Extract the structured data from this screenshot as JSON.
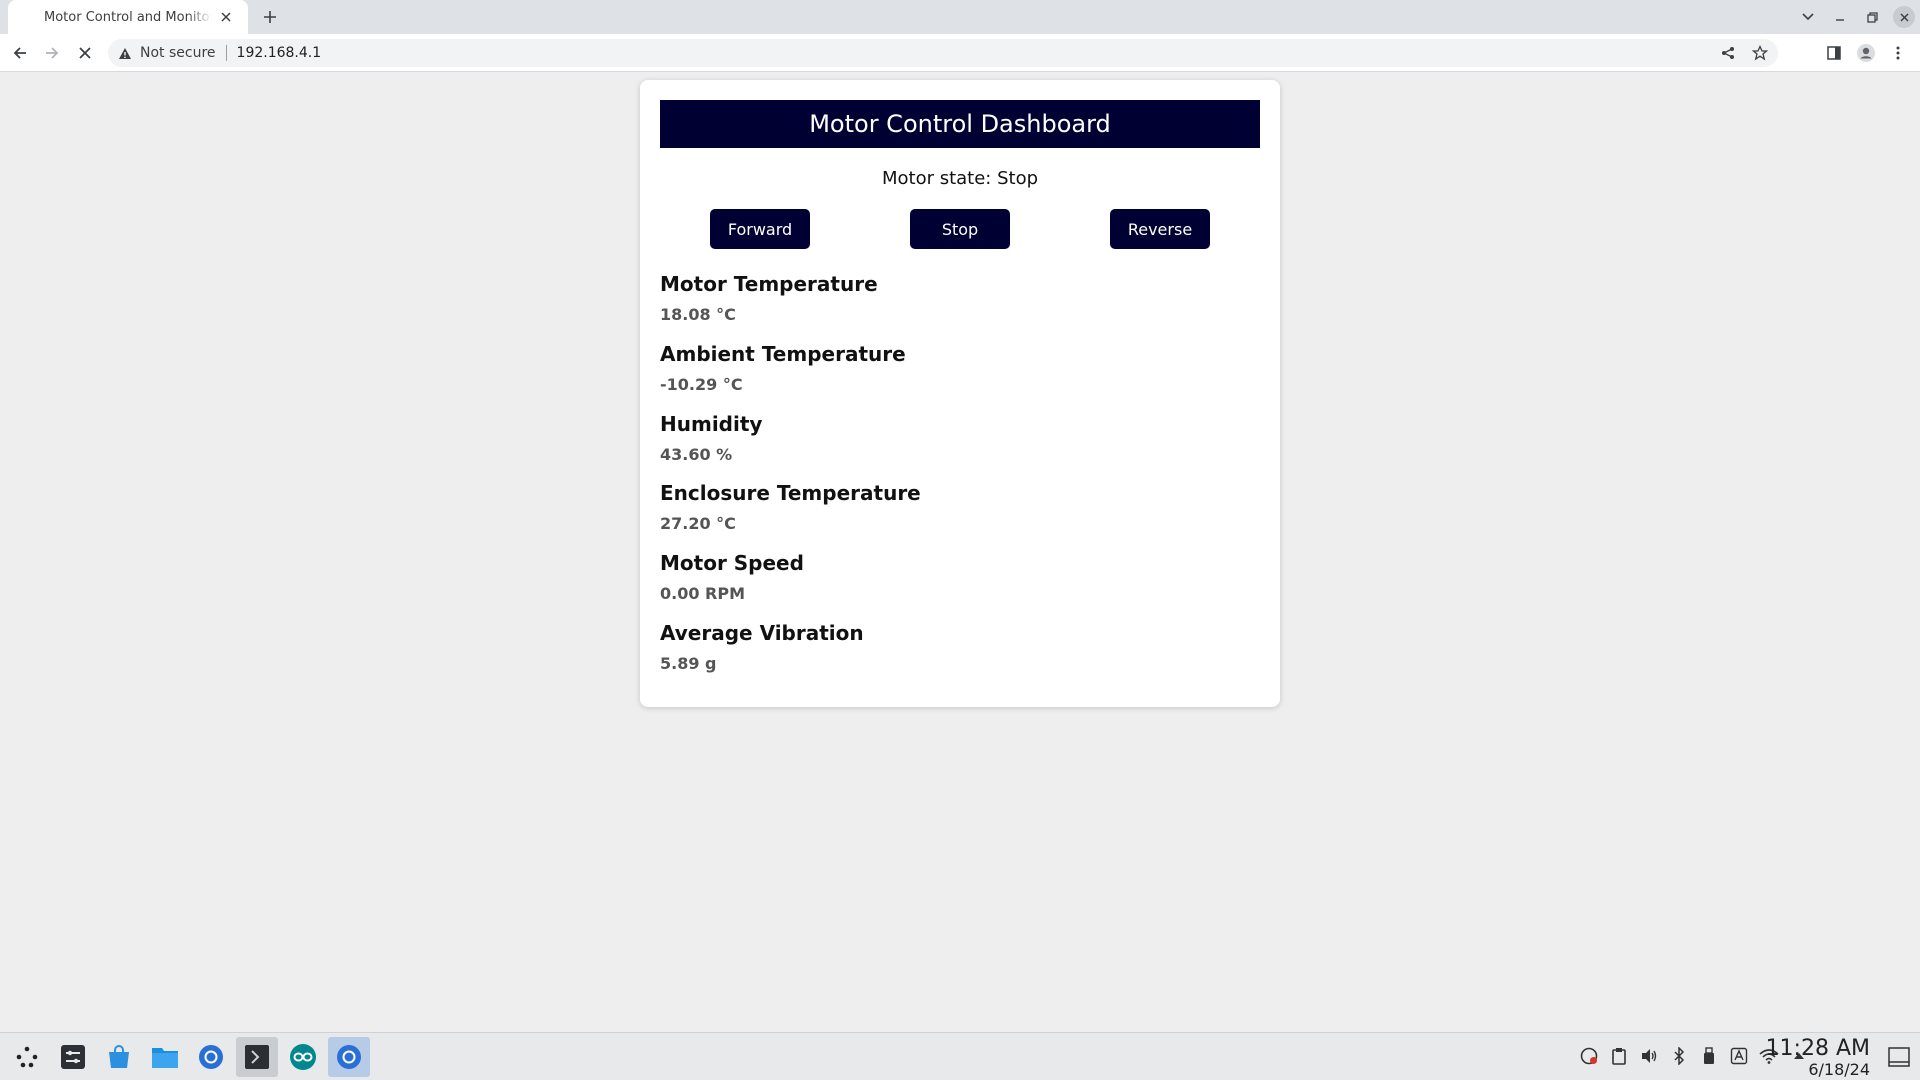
{
  "browser": {
    "tab_title": "Motor Control and Monitoring",
    "security_label": "Not secure",
    "url": "192.168.4.1"
  },
  "page": {
    "title": "Motor Control Dashboard",
    "motor_state": "Motor state: Stop",
    "buttons": {
      "forward": "Forward",
      "stop": "Stop",
      "reverse": "Reverse"
    },
    "metrics": [
      {
        "title": "Motor Temperature",
        "value": "18.08 °C"
      },
      {
        "title": "Ambient Temperature",
        "value": "-10.29 °C"
      },
      {
        "title": "Humidity",
        "value": "43.60 %"
      },
      {
        "title": "Enclosure Temperature",
        "value": "27.20 °C"
      },
      {
        "title": "Motor Speed",
        "value": "0.00 RPM"
      },
      {
        "title": "Average Vibration",
        "value": "5.89 g"
      }
    ]
  },
  "taskbar": {
    "time": "11:28 AM",
    "date": "6/18/24",
    "apps": [
      "app-launcher-icon",
      "system-settings-icon",
      "discover-store-icon",
      "file-manager-icon",
      "chromium-icon",
      "terminal-icon",
      "arduino-ide-icon",
      "chromium-active-icon"
    ]
  },
  "colors": {
    "header_bg": "#000033",
    "button_bg": "#000033",
    "page_bg": "#eeeeee"
  }
}
